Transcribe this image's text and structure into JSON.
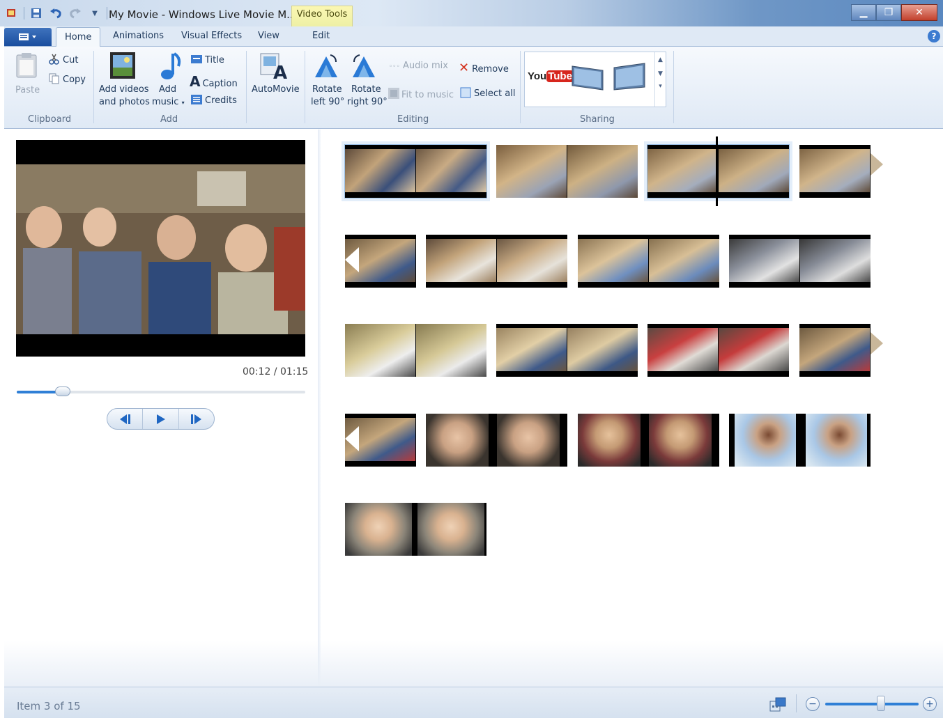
{
  "window": {
    "title": "My Movie - Windows Live Movie M...",
    "contextual_tab": "Video Tools"
  },
  "tabs": [
    "Home",
    "Animations",
    "Visual Effects",
    "View",
    "Edit"
  ],
  "clipboard": {
    "paste": "Paste",
    "cut": "Cut",
    "copy": "Copy",
    "group_label": "Clipboard"
  },
  "add": {
    "add_videos_line1": "Add videos",
    "add_videos_line2": "and photos",
    "add_music_line1": "Add",
    "add_music_line2": "music",
    "title": "Title",
    "caption": "Caption",
    "credits": "Credits",
    "group_label": "Add"
  },
  "automovie": "AutoMovie",
  "editing": {
    "rotate_left_line1": "Rotate",
    "rotate_left_line2": "left 90°",
    "rotate_right_line1": "Rotate",
    "rotate_right_line2": "right 90°",
    "audio_mix": "Audio mix",
    "fit_to_music": "Fit to music",
    "remove": "Remove",
    "select_all": "Select all",
    "group_label": "Editing"
  },
  "sharing": {
    "youtube_logo": "YouTube",
    "group_label": "Sharing"
  },
  "preview": {
    "time": "00:12 / 01:15",
    "progress": 0.16
  },
  "status": {
    "item_text": "Item 3 of 15",
    "zoom_level": 0.6
  },
  "colors": {
    "accent": "#2f7fd6",
    "ribbon": "#dfe9f5",
    "video_tools": "#eef0a5"
  }
}
